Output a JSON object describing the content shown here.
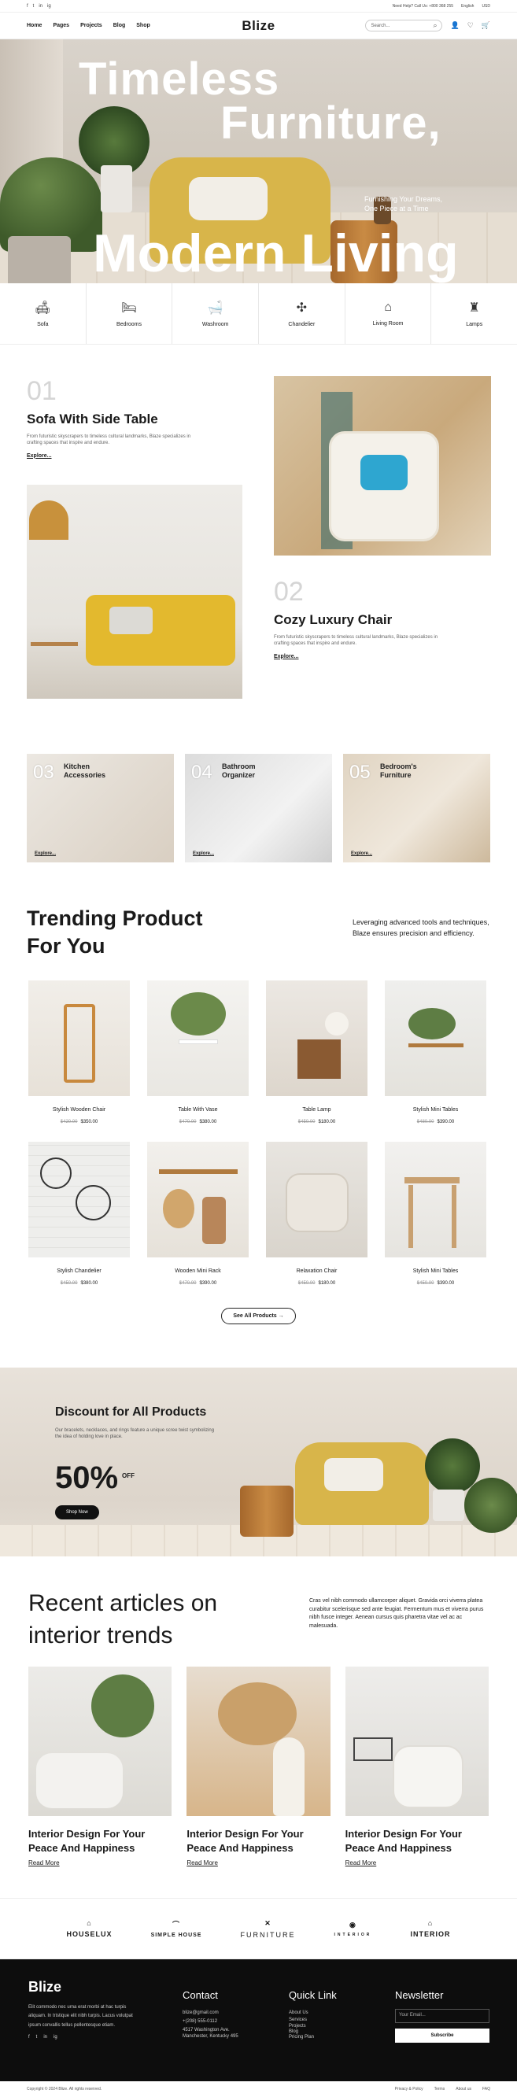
{
  "topbar": {
    "social": [
      "f",
      "t",
      "in",
      "ig"
    ],
    "hotline": "Need Help? Call Us: +800 368 255",
    "lang": "English",
    "currency": "USD"
  },
  "nav": {
    "menu": [
      "Home",
      "Pages",
      "Projects",
      "Blog",
      "Shop"
    ],
    "logo": "Blize",
    "search_placeholder": "Search..."
  },
  "hero": {
    "line1": "Timeless",
    "line2": "Furniture,",
    "line3": "Modern Living",
    "sub": "Furnishing Your Dreams, One Piece at a Time"
  },
  "categories": [
    {
      "label": "Sofa",
      "icon": "sofa-icon"
    },
    {
      "label": "Bedrooms",
      "icon": "bed-icon"
    },
    {
      "label": "Washroom",
      "icon": "bath-icon"
    },
    {
      "label": "Chandelier",
      "icon": "chandelier-icon"
    },
    {
      "label": "Living Room",
      "icon": "armchair-icon"
    },
    {
      "label": "Lamps",
      "icon": "lamp-icon"
    }
  ],
  "features": [
    {
      "num": "01",
      "title": "Sofa With Side Table",
      "desc": "From futuristic skyscrapers to timeless cultural landmarks, Blaze specializes in crafting spaces that inspire and endure.",
      "link": "Explore..."
    },
    {
      "num": "02",
      "title": "Cozy Luxury  Chair",
      "desc": "From futuristic skyscrapers to timeless cultural landmarks, Blaze specializes in crafting spaces that inspire and endure.",
      "link": "Explore..."
    }
  ],
  "rooms": [
    {
      "num": "03",
      "title": "Kitchen Accessories",
      "link": "Explore..."
    },
    {
      "num": "04",
      "title": "Bathroom Organizer",
      "link": "Explore..."
    },
    {
      "num": "05",
      "title": "Bedroom's Furniture",
      "link": "Explore..."
    }
  ],
  "trending": {
    "title": "Trending Product For You",
    "desc": "Leveraging advanced tools and techniques, Blaze ensures precision and efficiency.",
    "see_all": "See All Products"
  },
  "products": [
    {
      "name": "Stylish Wooden Chair",
      "old": "$420.00",
      "price": "$350.00"
    },
    {
      "name": "Table With Vase",
      "old": "$470.00",
      "price": "$380.00"
    },
    {
      "name": "Table Lamp",
      "old": "$450.00",
      "price": "$180.00"
    },
    {
      "name": "Stylish Mini Tables",
      "old": "$480.00",
      "price": "$390.00"
    },
    {
      "name": "Stylish Chandelier",
      "old": "$450.00",
      "price": "$380.00"
    },
    {
      "name": "Wooden Mini Rack",
      "old": "$470.00",
      "price": "$390.00"
    },
    {
      "name": "Relaxation Chair",
      "old": "$450.00",
      "price": "$180.00"
    },
    {
      "name": "Stylish Mini Tables",
      "old": "$450.00",
      "price": "$390.00"
    }
  ],
  "discount": {
    "title": "Discount for All Products",
    "desc": "Our bracelets, necklaces, and rings feature a unique scree twist symbolizing the idea of holding love in place.",
    "percent": "50%",
    "off": "OFF",
    "button": "Shop Now"
  },
  "articles": {
    "title": "Recent articles on interior trends",
    "desc": "Cras vel nibh commodo ullamcorper aliquet. Gravida orci viverra platea curabitur scelerisque sed ante feugiat. Fermentum mus et viverra purus nibh fusce integer. Aenean cursus quis pharetra vitae vel ac ac malesuada.",
    "items": [
      {
        "title": "Interior Design For Your Peace And Happiness",
        "link": "Read More"
      },
      {
        "title": "Interior Design For Your Peace And Happiness",
        "link": "Read More"
      },
      {
        "title": "Interior Design For Your Peace And Happiness",
        "link": "Read More"
      }
    ]
  },
  "brands": [
    "HOUSELUX",
    "SIMPLE HOUSE",
    "FURNITURE",
    "INTERIOR",
    "INTERIOR"
  ],
  "footer": {
    "logo": "Blize",
    "about": "Elit commodo nec urna erat morbi at hac turpis aliquam. In tristique elit nibh turpis. Lacus volutpat ipsum convallis tellus pellentesque etiam.",
    "contact_title": "Contact",
    "email": "blize@gmail.com",
    "phone": "+(208) 555-0112",
    "address": "4517 Washington Ave. Manchester, Kentucky 495",
    "quick_title": "Quick Link",
    "links": [
      "About Us",
      "Services",
      "Projects",
      "Blog",
      "Pricing Plan"
    ],
    "news_title": "Newsletter",
    "email_placeholder": "Your Email...",
    "subscribe": "Subscribe",
    "copyright": "Copyright © 2024 Blize. All rights reserved.",
    "bottom_links": [
      "Privacy & Policy",
      "Terms",
      "About us",
      "FAQ"
    ]
  }
}
